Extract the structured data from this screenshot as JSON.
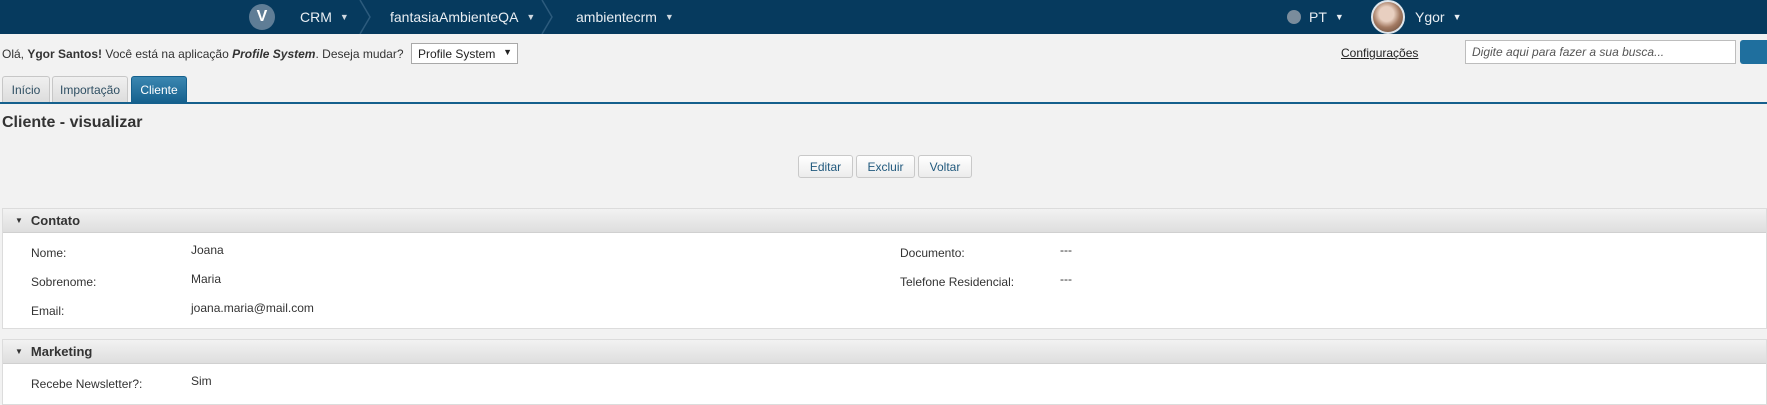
{
  "topbar": {
    "logo": "V",
    "crumbs": [
      "CRM",
      "fantasiaAmbienteQA",
      "ambientecrm"
    ],
    "language": "PT",
    "user": "Ygor"
  },
  "subbar": {
    "greeting_prefix": "Olá, ",
    "user_full_name": "Ygor Santos!",
    "greeting_mid": " Você está na aplicação ",
    "app_name": "Profile System",
    "greeting_suffix": ". Deseja mudar?",
    "app_select_value": "Profile System",
    "config_link": "Configurações",
    "search_placeholder": "Digite aqui para fazer a sua busca..."
  },
  "tabs": [
    {
      "label": "Início",
      "active": false
    },
    {
      "label": "Importação",
      "active": false
    },
    {
      "label": "Cliente",
      "active": true
    }
  ],
  "page_title": "Cliente - visualizar",
  "actions": {
    "edit": "Editar",
    "delete": "Excluir",
    "back": "Voltar"
  },
  "sections": {
    "contato": {
      "title": "Contato",
      "fields": [
        {
          "label": "Nome:",
          "value": "Joana"
        },
        {
          "label": "Sobrenome:",
          "value": "Maria"
        },
        {
          "label": "Email:",
          "value": "joana.maria@mail.com"
        },
        {
          "label": "Documento:",
          "value": "---"
        },
        {
          "label": "Telefone Residencial:",
          "value": "---"
        }
      ]
    },
    "marketing": {
      "title": "Marketing",
      "fields": [
        {
          "label": "Recebe Newsletter?:",
          "value": "Sim"
        }
      ]
    }
  }
}
